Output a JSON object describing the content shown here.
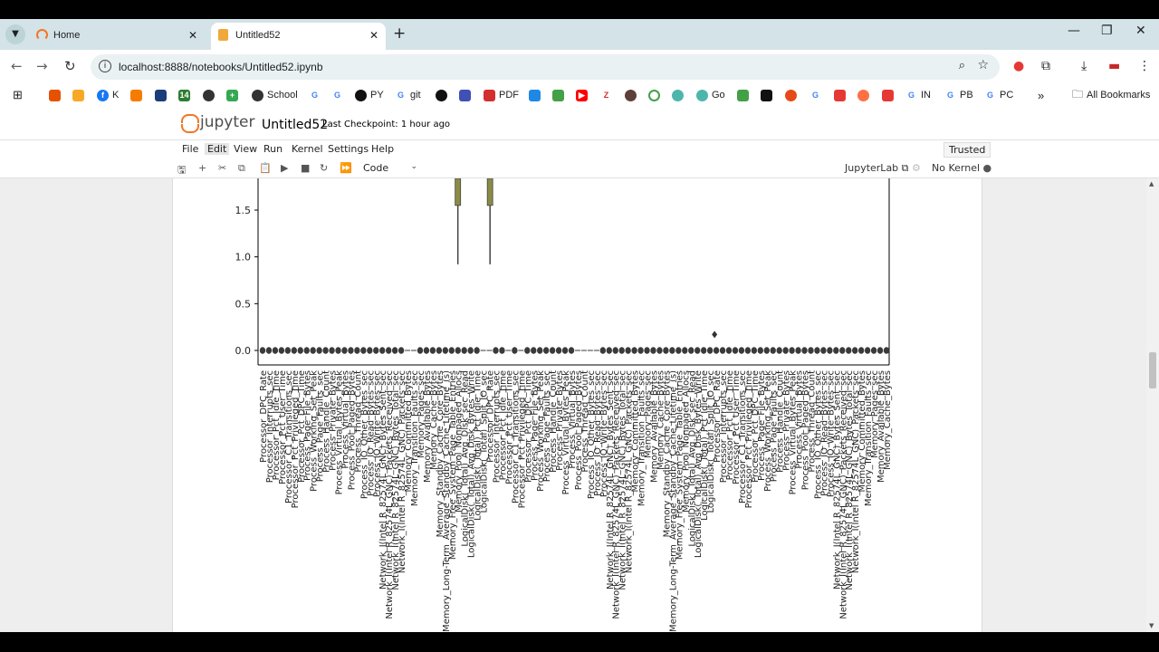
{
  "browser": {
    "tabs": [
      {
        "title": "Home",
        "active": false
      },
      {
        "title": "Untitled52",
        "active": true
      }
    ],
    "url": "localhost:8888/notebooks/Untitled52.ipynb",
    "bookmarks": [
      {
        "label": "",
        "icon": "apps-icon"
      },
      {
        "label": "",
        "icon": "bookmark-app-icon"
      },
      {
        "label": "",
        "icon": "bookmark-app-icon"
      },
      {
        "label": "K",
        "icon": "facebook-icon"
      },
      {
        "label": "",
        "icon": "analytics-icon"
      },
      {
        "label": "",
        "icon": "ieee-icon"
      },
      {
        "label": "",
        "icon": "calendar-icon"
      },
      {
        "label": "",
        "icon": "globe-icon"
      },
      {
        "label": "",
        "icon": "sheets-icon"
      },
      {
        "label": "School",
        "icon": "globe-icon"
      },
      {
        "label": "",
        "icon": "google-icon"
      },
      {
        "label": "",
        "icon": "google-icon"
      },
      {
        "label": "PY",
        "icon": "github-icon"
      },
      {
        "label": "git",
        "icon": "google-icon"
      },
      {
        "label": "",
        "icon": "openai-icon"
      },
      {
        "label": "",
        "icon": "bookmark-app-icon"
      },
      {
        "label": "PDF",
        "icon": "pdf-icon"
      },
      {
        "label": "",
        "icon": "bookmark-app-icon"
      },
      {
        "label": "",
        "icon": "android-icon"
      },
      {
        "label": "",
        "icon": "youtube-icon"
      },
      {
        "label": "",
        "icon": "zotero-icon"
      },
      {
        "label": "",
        "icon": "bookmark-app-icon"
      },
      {
        "label": "",
        "icon": "bookmark-app-icon"
      },
      {
        "label": "",
        "icon": "bookmark-app-icon"
      },
      {
        "label": "Go",
        "icon": "bookmark-app-icon"
      },
      {
        "label": "",
        "icon": "bookmark-app-icon"
      },
      {
        "label": "",
        "icon": "bookmark-app-icon"
      },
      {
        "label": "",
        "icon": "bookmark-app-icon"
      },
      {
        "label": "",
        "icon": "google-icon"
      },
      {
        "label": "",
        "icon": "bookmark-app-icon"
      },
      {
        "label": "",
        "icon": "bookmark-app-icon"
      },
      {
        "label": "IN",
        "icon": "google-icon"
      },
      {
        "label": "PB",
        "icon": "google-icon"
      },
      {
        "label": "PC",
        "icon": "google-icon"
      }
    ],
    "overflow_label": "»",
    "all_bookmarks_label": "All Bookmarks"
  },
  "jupyter": {
    "logo_text": "jupyter",
    "notebook_name": "Untitled52",
    "checkpoint": "Last Checkpoint: 1 hour ago",
    "menus": [
      "File",
      "Edit",
      "View",
      "Run",
      "Kernel",
      "Settings",
      "Help"
    ],
    "highlighted_menu": "Edit",
    "trusted_label": "Trusted",
    "cell_type": "Code",
    "jupyterlab_link": "JupyterLab",
    "kernel_status": "No Kernel"
  },
  "chart_data": {
    "type": "box",
    "y_ticks": [
      "1.5",
      "1.0",
      "0.5",
      "0.0"
    ],
    "ylim": [
      0,
      1.6
    ],
    "series_count": 100,
    "categories": [
      "Processor_DPC_Rate",
      "Processor_Interrupts_sec",
      "Processor_Pct_Idle_Time",
      "Processor_Pct_User_Time",
      "Processor_C1_Transitions_sec",
      "Processor_Pct_Privileged_Time",
      "Processor_Pct_DPC_Time",
      "Process_Page_File_Bytes",
      "Process_Working_Set_Peak",
      "Process_Page_Faults_sec",
      "Process_Handle_Count",
      "Process_Private_Bytes",
      "Process_Virtual_Bytes_Peak",
      "Process_Virtual_Bytes",
      "Process_Pool_Paged_Bytes",
      "Process_Thread_Count",
      "Process_IO_Other_Bytes_sec",
      "Process_IO_Read_Bytes_sec",
      "Process_IO_Write_Bytes_sec",
      "Network_I(Intel R_82574L_GNC)_Bytes_Sent_sec",
      "Network_I(Intel R_82574L_GNC)_Packets_Received_sec",
      "Network_I(Intel R_82574L_GNC)_Bytes_Total_sec",
      "Network_I(Intel R_82574L_GNC)_Packets_sec",
      "Memory_Committed_Bytes",
      "Memory_Transition_Faults_sec",
      "Memory_Pages_sec",
      "Memory_Available_Bytes",
      "Memory_Cache_Bytes",
      "Memory_Standby_Cache_Core_Bytes",
      "Memory_Long-Term_Average_Standby_Cache_Lifetime_(s)",
      "Memory_Free_System_Page_Table_Entries",
      "Memory_Pool_Nonpaged_Allocs",
      "LogicalDisk(_Total)_Avg_Disk_sec_Read",
      "LogicalDisk(_Total)_Avg_Disk_Bytes_Write",
      "LogicalDisk(_Total)_Pct_Idle_Time",
      "LogicalDisk(_Total)_Split_IO_sec"
    ],
    "visible_tick_label_rows": [
      "Processor_DPC_Rate",
      "Processor_Interrupts_sec",
      "Processor_Pct_Idle_Time",
      "Memory Transition",
      "Memory Long-Term",
      "LogicalDisk(_Total)"
    ],
    "tall_boxes": [
      {
        "index": 17,
        "whisker_low": 0.92,
        "box_low": 1.55
      },
      {
        "index": 22,
        "whisker_low": 0.92,
        "box_low": 1.55
      }
    ],
    "outliers": [
      {
        "index": 70,
        "value": 0.17
      }
    ],
    "gaps": [
      23,
      24,
      35,
      36,
      39,
      41,
      50,
      51,
      52,
      53
    ],
    "baseline_value": 0.0,
    "colors": {
      "box": "#8b8b45",
      "marker": "#3a3a3a",
      "axis": "#000000"
    }
  }
}
